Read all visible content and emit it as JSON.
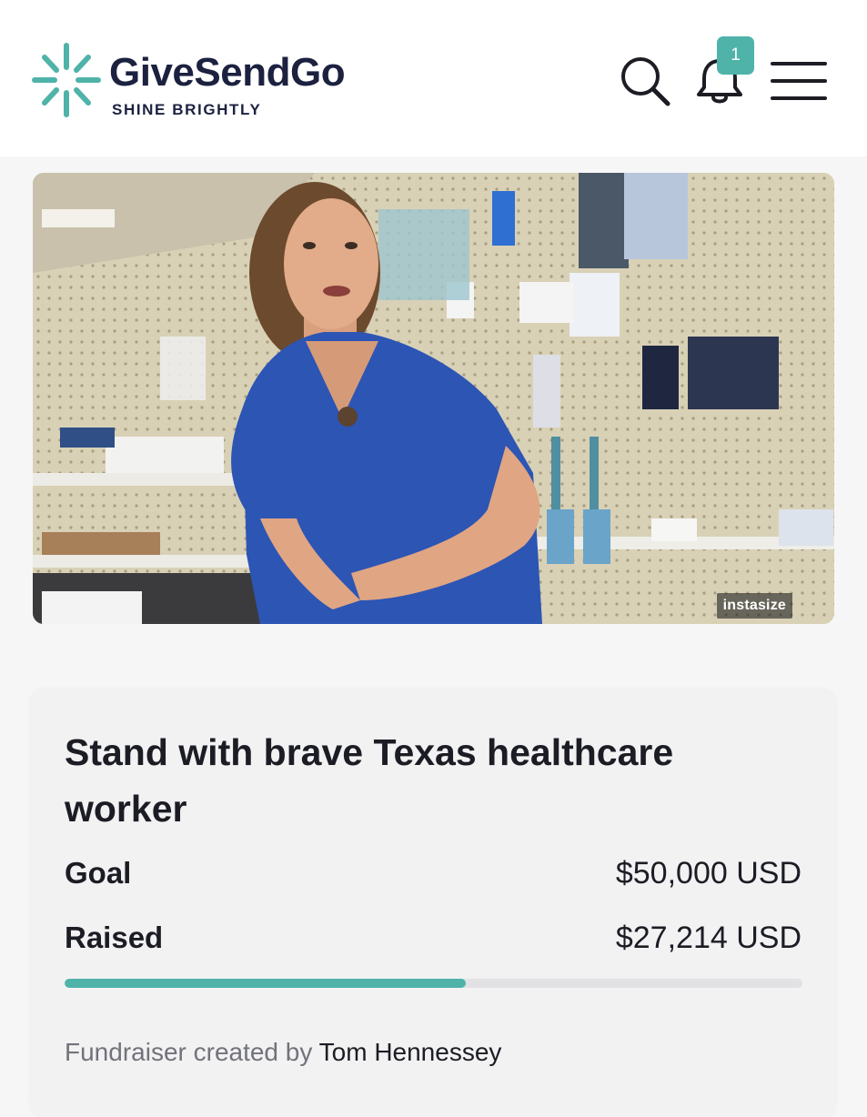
{
  "brand": {
    "name": "GiveSendGo",
    "tagline": "SHINE BRIGHTLY",
    "accent": "#4fb3aa",
    "ink": "#1c2140"
  },
  "header": {
    "notification_count": "1",
    "icons": [
      "search-icon",
      "bell-icon",
      "hamburger-menu-icon"
    ]
  },
  "hero": {
    "watermark": "instasize"
  },
  "campaign": {
    "title": "Stand with brave Texas healthcare worker",
    "goal_label": "Goal",
    "goal_value": "$50,000 USD",
    "raised_label": "Raised",
    "raised_value": "$27,214 USD",
    "progress_fraction": 0.5443,
    "creator_prefix": "Fundraiser created by",
    "creator_name": "Tom Hennessey"
  }
}
